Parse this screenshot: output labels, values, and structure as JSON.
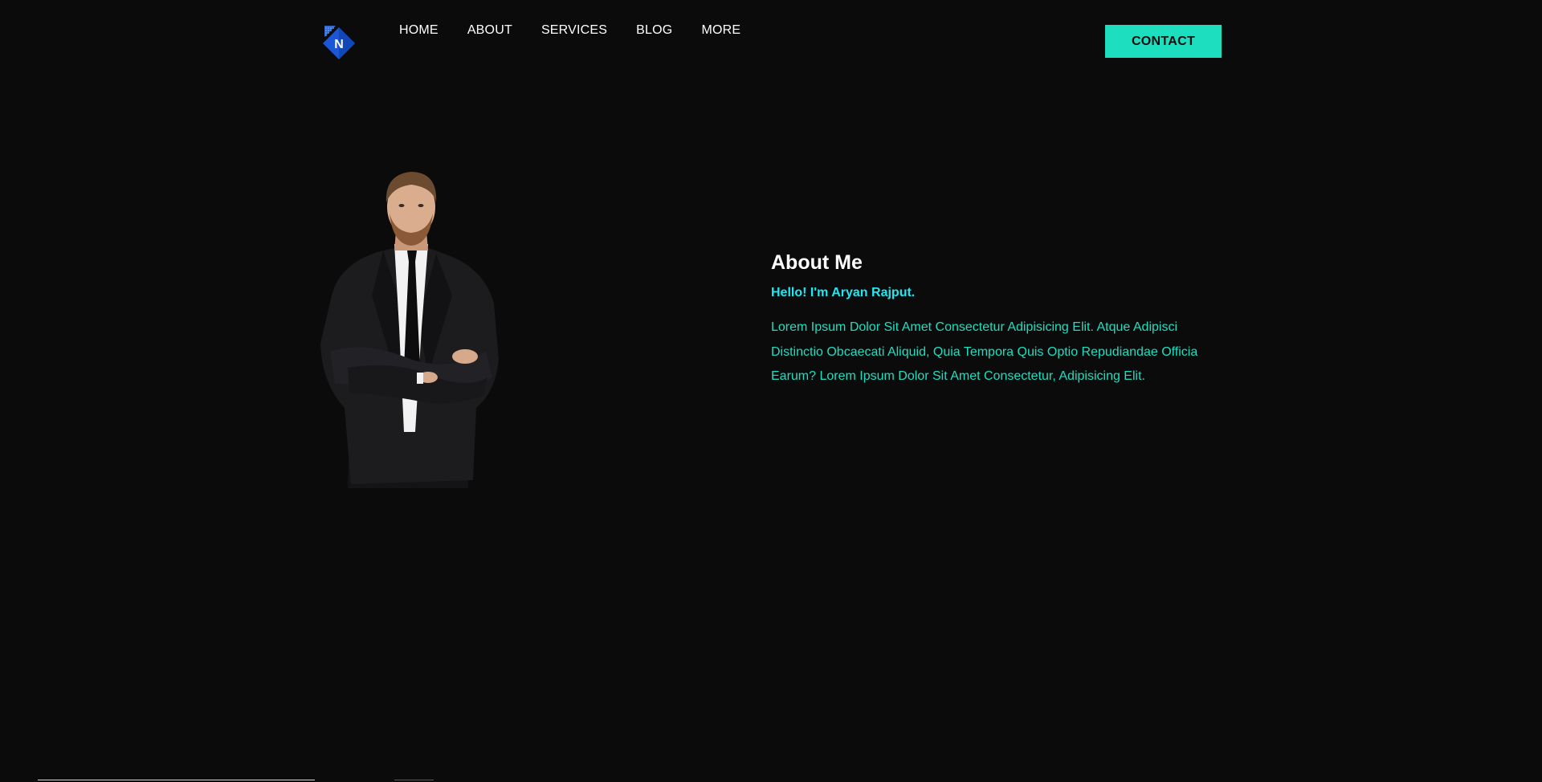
{
  "brand": {
    "logo_letter": "N",
    "logo_color": "#1a56d6"
  },
  "nav": {
    "items": [
      {
        "label": "HOME"
      },
      {
        "label": "ABOUT"
      },
      {
        "label": "SERVICES"
      },
      {
        "label": "BLOG"
      },
      {
        "label": "MORE"
      }
    ],
    "contact_label": "CONTACT"
  },
  "about": {
    "title": "About Me",
    "greeting": "Hello! I'm Aryan Rajput.",
    "body": "Lorem Ipsum Dolor Sit Amet Consectetur Adipisicing Elit. Atque Adipisci Distinctio Obcaecati Aliquid, Quia Tempora Quis Optio Repudiandae Officia Earum? Lorem Ipsum Dolor Sit Amet Consectetur, Adipisicing Elit."
  },
  "colors": {
    "background": "#0b0b0c",
    "accent": "#1ddfc0",
    "greeting": "#22e6f0",
    "text": "#ffffff"
  }
}
